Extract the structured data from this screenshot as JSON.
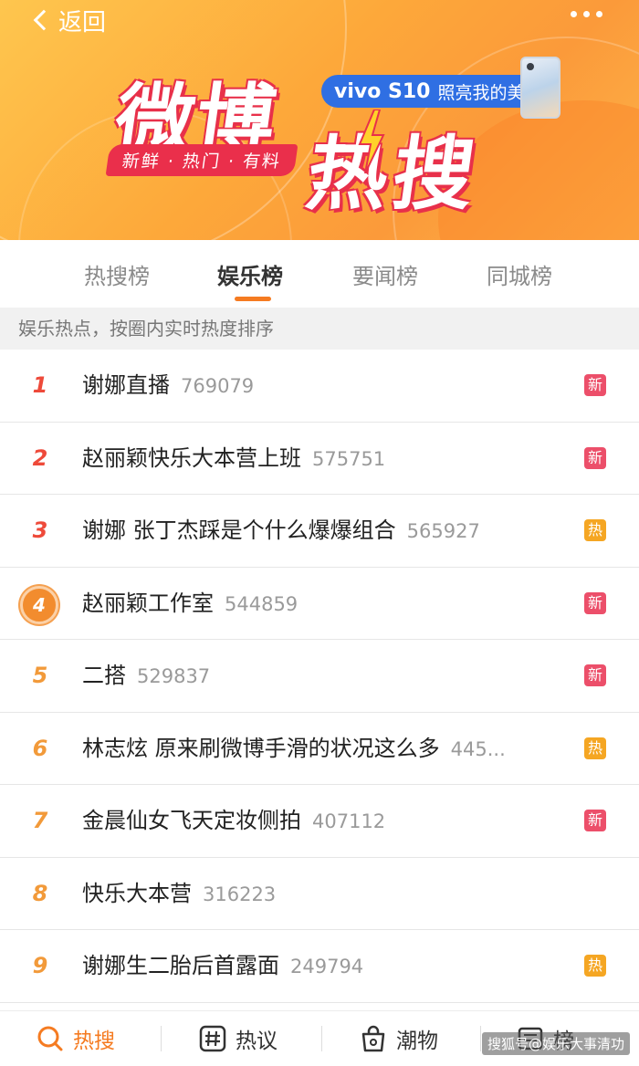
{
  "header": {
    "back_label": "返回",
    "title_main": "微博",
    "title_sub": "热搜",
    "slogan": "新鲜 · 热门 · 有料",
    "ad": {
      "brand": "vivo S10",
      "tagline": "照亮我的美"
    }
  },
  "tabs": [
    {
      "label": "热搜榜",
      "active": false
    },
    {
      "label": "娱乐榜",
      "active": true
    },
    {
      "label": "要闻榜",
      "active": false
    },
    {
      "label": "同城榜",
      "active": false
    }
  ],
  "notice": "娱乐热点，按圈内实时热度排序",
  "list": [
    {
      "rank": "1",
      "topic": "谢娜直播",
      "heat": "769079",
      "tag": "新"
    },
    {
      "rank": "2",
      "topic": "赵丽颖快乐大本营上班",
      "heat": "575751",
      "tag": "新"
    },
    {
      "rank": "3",
      "topic": "谢娜 张丁杰踩是个什么爆爆组合",
      "heat": "565927",
      "tag": "热"
    },
    {
      "rank": "4",
      "topic": "赵丽颖工作室",
      "heat": "544859",
      "tag": "新"
    },
    {
      "rank": "5",
      "topic": "二搭",
      "heat": "529837",
      "tag": "新"
    },
    {
      "rank": "6",
      "topic": "林志炫 原来刷微博手滑的状况这么多",
      "heat": "445...",
      "tag": "热"
    },
    {
      "rank": "7",
      "topic": "金晨仙女飞天定妆侧拍",
      "heat": "407112",
      "tag": "新"
    },
    {
      "rank": "8",
      "topic": "快乐大本营",
      "heat": "316223",
      "tag": ""
    },
    {
      "rank": "9",
      "topic": "谢娜生二胎后首露面",
      "heat": "249794",
      "tag": "热"
    }
  ],
  "bottom_nav": [
    {
      "label": "热搜",
      "icon": "search-icon",
      "active": true
    },
    {
      "label": "热议",
      "icon": "hashtag-icon",
      "active": false
    },
    {
      "label": "潮物",
      "icon": "shopping-bag-icon",
      "active": false
    },
    {
      "label": "榜",
      "icon": "list-icon",
      "active": false
    }
  ],
  "watermark": "搜狐号@娱乐大事清功",
  "colors": {
    "accent": "#f57b21",
    "rank_hot": "#ee4a3a",
    "rank_warm": "#f29a3a",
    "tag_new": "#ec4f6a",
    "tag_hot": "#f5a623",
    "brand_red": "#ea2f4b"
  }
}
